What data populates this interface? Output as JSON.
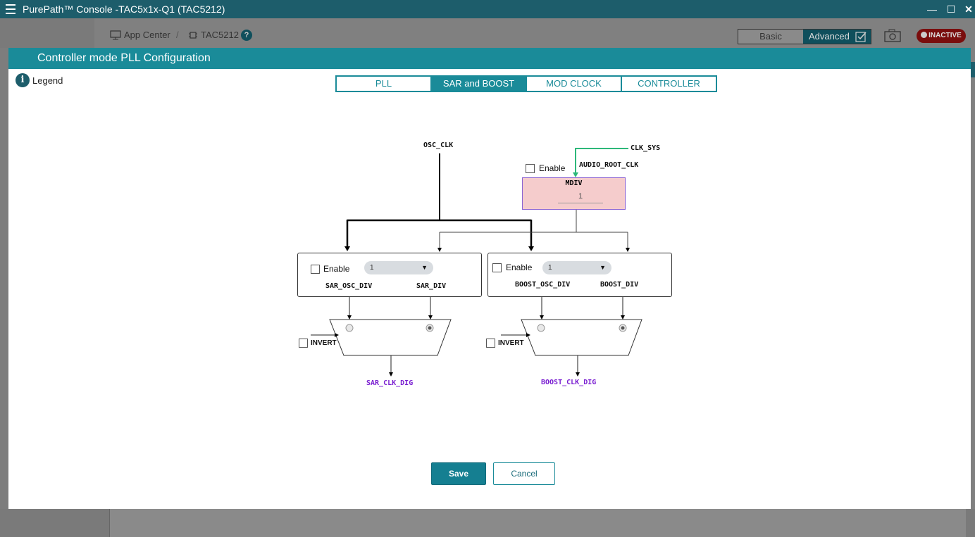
{
  "window": {
    "title": "PurePath™ Console -TAC5x1x-Q1 (TAC5212)",
    "minimize": "—",
    "maximize": "☐",
    "close": "✕"
  },
  "appbar": {
    "app_center": "App Center",
    "device": "TAC5212",
    "help": "?",
    "mode_basic": "Basic",
    "mode_advanced": "Advanced",
    "status": "INACTIVE"
  },
  "dialog": {
    "title": "Controller mode PLL Configuration",
    "legend": "Legend",
    "tabs": [
      {
        "label": "PLL",
        "active": false
      },
      {
        "label": "SAR and BOOST",
        "active": true
      },
      {
        "label": "MOD CLOCK",
        "active": false
      },
      {
        "label": "CONTROLLER",
        "active": false
      }
    ],
    "save": "Save",
    "cancel": "Cancel"
  },
  "diagram": {
    "osc_clk": "OSC_CLK",
    "clk_sys": "CLK_SYS",
    "audio_root_clk": "AUDIO_ROOT_CLK",
    "mdiv": {
      "enable_label": "Enable",
      "enabled": false,
      "title": "MDIV",
      "value": "1"
    },
    "sar": {
      "enable_label": "Enable",
      "enabled": false,
      "select_value": "1",
      "osc_div_label": "SAR_OSC_DIV",
      "div_label": "SAR_DIV",
      "invert_label": "INVERT",
      "invert": false,
      "output_label": "SAR_CLK_DIG",
      "selected_input": "SAR_DIV"
    },
    "boost": {
      "enable_label": "Enable",
      "enabled": false,
      "select_value": "1",
      "osc_div_label": "BOOST_OSC_DIV",
      "div_label": "BOOST_DIV",
      "invert_label": "INVERT",
      "invert": false,
      "output_label": "BOOST_CLK_DIG",
      "selected_input": "BOOST_DIV"
    }
  },
  "colors": {
    "titlebar": "#1d5d6b",
    "dialog_header": "#1a8b99",
    "mdiv_fill": "#f5cccc",
    "clk_sys_line": "#2db87a",
    "output_label": "#7a1fd1",
    "inactive_badge": "#7a0d0d"
  }
}
